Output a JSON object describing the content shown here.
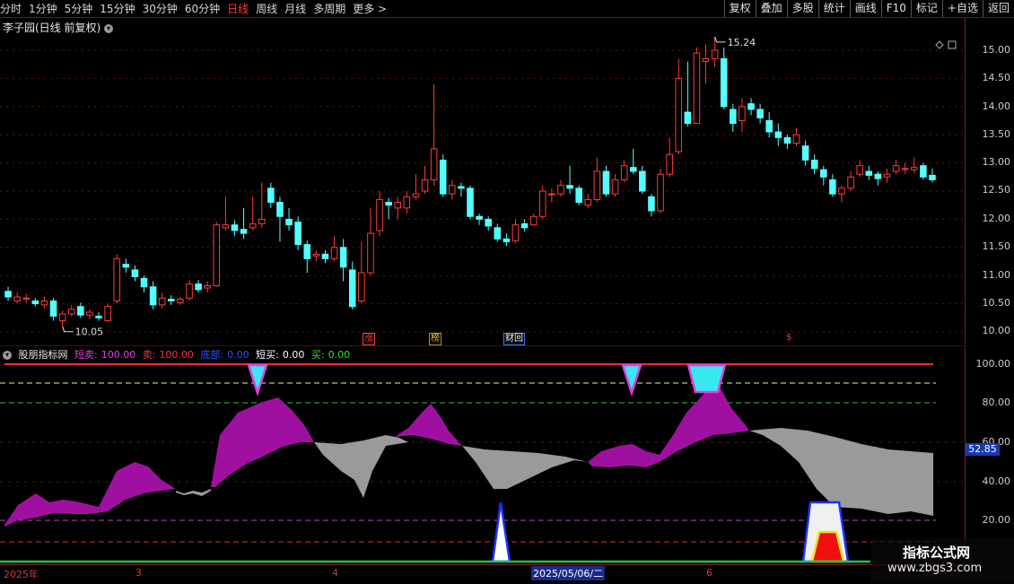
{
  "toolbar": {
    "periods": [
      "分时",
      "1分钟",
      "5分钟",
      "15分钟",
      "30分钟",
      "60分钟",
      "日线",
      "周线",
      "月线",
      "多周期",
      "更多 >"
    ],
    "active_period": "日线",
    "actions": [
      "复权",
      "叠加",
      "多股",
      "统计",
      "画线",
      "F10",
      "标记",
      "+自选",
      "返回"
    ]
  },
  "main_title": "李子园(日线 前复权)",
  "price_axis": [
    "15.00",
    "14.50",
    "14.00",
    "13.50",
    "13.00",
    "12.50",
    "12.00",
    "11.50",
    "11.00",
    "10.50",
    "10.00"
  ],
  "hi_label": "15.24",
  "lo_label": "10.05",
  "event_badges": [
    "涨",
    "榜",
    "财回",
    "$"
  ],
  "indicator": {
    "name": "股朋指标网",
    "items": [
      {
        "label": "短卖:",
        "value": "100.00",
        "color": "#e040e0"
      },
      {
        "label": "卖:",
        "value": "100.00",
        "color": "#ff3030"
      },
      {
        "label": "底部:",
        "value": "0.00",
        "color": "#3050ff"
      },
      {
        "label": "短买:",
        "value": "0.00",
        "color": "#ffffff"
      },
      {
        "label": "买:",
        "value": "0.00",
        "color": "#30e030"
      }
    ],
    "axis": [
      "100.00",
      "80.00",
      "60.00",
      "40.00",
      "20.00"
    ],
    "current_value": "52.85"
  },
  "date_axis": [
    "2025年",
    "3",
    "4",
    "2025/05/06/二",
    "6"
  ],
  "watermark": {
    "title": "指标公式网",
    "url": "www.zbgs3.com"
  },
  "colors": {
    "up": "#ff3b3b",
    "down": "#54ffff",
    "purple": "#a010a0",
    "gray": "#9a9a9a"
  },
  "chart_data": {
    "type": "candlestick",
    "ylim": [
      10.0,
      15.3
    ],
    "candles": [
      [
        10.72,
        10.62,
        10.8,
        10.55
      ],
      [
        10.55,
        10.62,
        10.7,
        10.5
      ],
      [
        10.6,
        10.6,
        10.68,
        10.52
      ],
      [
        10.55,
        10.5,
        10.6,
        10.45
      ],
      [
        10.48,
        10.55,
        10.62,
        10.42
      ],
      [
        10.55,
        10.28,
        10.6,
        10.2
      ],
      [
        10.2,
        10.32,
        10.38,
        10.1
      ],
      [
        10.32,
        10.4,
        10.48,
        10.28
      ],
      [
        10.45,
        10.3,
        10.52,
        10.25
      ],
      [
        10.3,
        10.35,
        10.4,
        10.22
      ],
      [
        10.28,
        10.25,
        10.35,
        10.2
      ],
      [
        10.2,
        10.45,
        10.5,
        10.18
      ],
      [
        10.55,
        11.3,
        11.38,
        10.5
      ],
      [
        11.2,
        11.15,
        11.3,
        11.05
      ],
      [
        11.1,
        10.98,
        11.18,
        10.9
      ],
      [
        10.95,
        10.8,
        11.0,
        10.7
      ],
      [
        10.8,
        10.48,
        10.9,
        10.4
      ],
      [
        10.48,
        10.6,
        10.7,
        10.42
      ],
      [
        10.58,
        10.55,
        10.65,
        10.48
      ],
      [
        10.52,
        10.58,
        10.62,
        10.48
      ],
      [
        10.6,
        10.85,
        10.92,
        10.55
      ],
      [
        10.85,
        10.75,
        10.92,
        10.7
      ],
      [
        10.78,
        10.82,
        10.9,
        10.7
      ],
      [
        10.82,
        11.9,
        11.95,
        10.8
      ],
      [
        11.85,
        11.9,
        12.4,
        11.8
      ],
      [
        11.9,
        11.8,
        11.98,
        11.7
      ],
      [
        11.82,
        11.75,
        12.2,
        11.65
      ],
      [
        11.85,
        11.92,
        12.4,
        11.8
      ],
      [
        11.92,
        12.0,
        12.65,
        11.85
      ],
      [
        12.55,
        12.3,
        12.65,
        12.2
      ],
      [
        12.3,
        12.05,
        12.4,
        11.6
      ],
      [
        12.0,
        11.9,
        12.2,
        11.8
      ],
      [
        11.95,
        11.55,
        12.05,
        11.45
      ],
      [
        11.55,
        11.3,
        11.62,
        11.05
      ],
      [
        11.35,
        11.38,
        11.45,
        11.25
      ],
      [
        11.38,
        11.3,
        11.45,
        11.22
      ],
      [
        11.3,
        11.5,
        11.7,
        11.25
      ],
      [
        11.5,
        11.15,
        11.65,
        10.9
      ],
      [
        11.1,
        10.45,
        11.25,
        10.4
      ],
      [
        10.55,
        11.05,
        11.6,
        10.5
      ],
      [
        11.05,
        11.75,
        12.2,
        11.0
      ],
      [
        11.8,
        12.35,
        12.5,
        11.7
      ],
      [
        12.3,
        12.25,
        12.38,
        12.0
      ],
      [
        12.2,
        12.3,
        12.4,
        12.0
      ],
      [
        12.2,
        12.4,
        12.5,
        12.1
      ],
      [
        12.4,
        12.45,
        12.8,
        12.35
      ],
      [
        12.5,
        12.7,
        12.95,
        12.45
      ],
      [
        12.7,
        13.25,
        14.4,
        12.6
      ],
      [
        13.05,
        12.45,
        13.15,
        12.4
      ],
      [
        12.45,
        12.6,
        12.7,
        12.35
      ],
      [
        12.58,
        12.55,
        12.65,
        12.4
      ],
      [
        12.55,
        12.05,
        12.6,
        12.0
      ],
      [
        12.05,
        12.0,
        12.1,
        11.9
      ],
      [
        12.0,
        11.88,
        12.05,
        11.8
      ],
      [
        11.85,
        11.65,
        11.92,
        11.6
      ],
      [
        11.65,
        11.6,
        11.75,
        11.52
      ],
      [
        11.62,
        11.9,
        12.0,
        11.58
      ],
      [
        11.92,
        11.85,
        12.0,
        11.78
      ],
      [
        11.9,
        12.05,
        12.1,
        11.88
      ],
      [
        12.05,
        12.5,
        12.6,
        12.0
      ],
      [
        12.45,
        12.45,
        12.55,
        12.3
      ],
      [
        12.45,
        12.6,
        12.7,
        12.4
      ],
      [
        12.6,
        12.55,
        12.95,
        12.45
      ],
      [
        12.55,
        12.3,
        12.6,
        12.25
      ],
      [
        12.25,
        12.35,
        12.45,
        12.2
      ],
      [
        12.35,
        12.85,
        13.1,
        12.3
      ],
      [
        12.85,
        12.45,
        12.95,
        12.4
      ],
      [
        12.45,
        12.7,
        12.8,
        12.4
      ],
      [
        12.7,
        12.95,
        13.05,
        12.65
      ],
      [
        12.92,
        12.85,
        13.25,
        12.8
      ],
      [
        12.85,
        12.5,
        12.95,
        12.45
      ],
      [
        12.4,
        12.15,
        12.45,
        12.05
      ],
      [
        12.15,
        12.8,
        12.9,
        12.1
      ],
      [
        12.8,
        13.15,
        13.45,
        12.75
      ],
      [
        13.2,
        14.5,
        14.85,
        13.15
      ],
      [
        13.9,
        13.7,
        14.8,
        13.65
      ],
      [
        13.7,
        14.95,
        15.05,
        13.7
      ],
      [
        14.8,
        14.85,
        15.1,
        14.4
      ],
      [
        14.85,
        15.0,
        15.24,
        14.7
      ],
      [
        14.85,
        14.0,
        15.05,
        13.95
      ],
      [
        13.95,
        13.7,
        14.05,
        13.55
      ],
      [
        13.75,
        14.0,
        14.15,
        13.55
      ],
      [
        14.05,
        13.95,
        14.15,
        13.85
      ],
      [
        13.95,
        13.8,
        14.05,
        13.7
      ],
      [
        13.75,
        13.55,
        13.9,
        13.45
      ],
      [
        13.55,
        13.45,
        13.7,
        13.3
      ],
      [
        13.45,
        13.35,
        13.5,
        13.25
      ],
      [
        13.35,
        13.5,
        13.62,
        13.3
      ],
      [
        13.3,
        13.05,
        13.4,
        12.95
      ],
      [
        13.05,
        12.9,
        13.15,
        12.8
      ],
      [
        12.88,
        12.75,
        12.95,
        12.6
      ],
      [
        12.7,
        12.45,
        12.8,
        12.4
      ],
      [
        12.45,
        12.55,
        12.6,
        12.3
      ],
      [
        12.55,
        12.75,
        12.85,
        12.5
      ],
      [
        12.8,
        12.95,
        13.05,
        12.75
      ],
      [
        12.85,
        12.78,
        12.95,
        12.7
      ],
      [
        12.8,
        12.72,
        12.85,
        12.6
      ],
      [
        12.75,
        12.8,
        12.9,
        12.65
      ],
      [
        12.85,
        12.95,
        13.05,
        12.8
      ],
      [
        12.9,
        12.9,
        13.0,
        12.8
      ],
      [
        12.88,
        12.92,
        13.1,
        12.82
      ],
      [
        12.95,
        12.75,
        13.0,
        12.7
      ],
      [
        12.78,
        12.7,
        12.9,
        12.65
      ]
    ]
  }
}
